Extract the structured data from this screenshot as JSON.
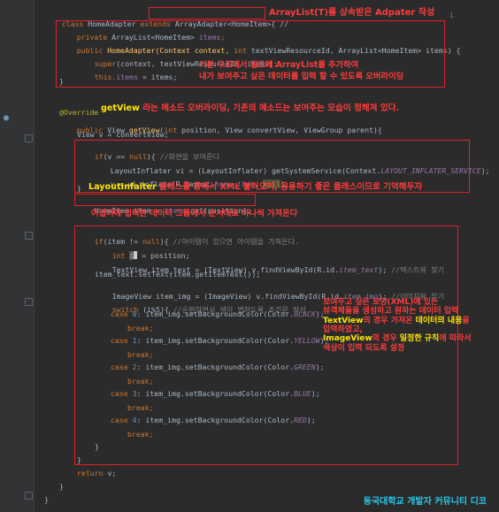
{
  "gutter": {
    "marker_glyph": "●"
  },
  "code": {
    "l01": {
      "a": "class ",
      "b": "HomeAdapter ",
      "c": "extends ",
      "d": "ArrayAdapter<HomeItem>{ //",
      "e": "i"
    },
    "l02": {
      "a": "private ",
      "b": "ArrayList<HomeItem> ",
      "c": "items",
      "d": ";"
    },
    "l03": {
      "a": "public ",
      "b": "HomeAdapter(Context context, ",
      "c": "int ",
      "d": "textViewResourceId, ArrayList<HomeItem> items) {"
    },
    "l04": {
      "a": "super",
      "b": "(context, textViewResourceId, items)",
      "c": ";"
    },
    "l05": {
      "a": "this.",
      "b": "items ",
      "c": "= items;"
    },
    "l06": {
      "a": "}"
    },
    "l07": {
      "a": "@Override"
    },
    "l08": {
      "a": "public ",
      "b": "View ",
      "c": "getView",
      "d": "(",
      "e": "int ",
      "f": "position, View convertView, ViewGroup parent){"
    },
    "l09": {
      "a": "View v = convertView;"
    },
    "l10": {
      "a": "if",
      "b": "(v == ",
      "c": "null",
      "d": "){ ",
      "e": "//화면을 보여준다"
    },
    "l11": {
      "a": "LayoutInflater vi = (LayoutInflater) getSystemService(Context.",
      "b": "LAYOUT_INFLATER_SERVICE",
      "c": ");"
    },
    "l12": {
      "a": "v = vi.inflate(R.layout.",
      "b": "home_item",
      "c": ", ",
      "d": "null",
      "e": ");"
    },
    "l13": {
      "a": "}"
    },
    "l14": {
      "a": "HomeItem item = ",
      "b": "items",
      "c": ".get(position);"
    },
    "l15": {
      "a": "if",
      "b": "(item != ",
      "c": "null",
      "d": "){ ",
      "e": "//아이템이 있으면 아이템을 가져온다."
    },
    "l16": {
      "a": "int ",
      "b": "i",
      "c": " = position;"
    },
    "l17": {
      "a": "TextView item_text = (TextView) v.findViewById(R.id.",
      "b": "item_text",
      "c": "); ",
      "d": "//텍스트뷰 찾기"
    },
    "l18": {
      "a": "item_text.setText(item.getItemText());"
    },
    "l19": {
      "a": "ImageView item_img = (ImageView) v.findViewById(R.id.",
      "b": "item_img",
      "c": "); ",
      "d": "//이미지뷰 찾기"
    },
    "l20": {
      "a": "switch ",
      "b": "(i%5){ ",
      "c": "//순환하면서 색이 변하도록 조건문 작성"
    },
    "c0": {
      "a": "case ",
      "b": "0",
      "c": ": item_img.setBackgroundColor(Color.",
      "d": "BLACK",
      "e": ");"
    },
    "c1": {
      "a": "case ",
      "b": "1",
      "c": ": item_img.setBackgroundColor(Color.",
      "d": "YELLOW",
      "e": ");"
    },
    "c2": {
      "a": "case ",
      "b": "2",
      "c": ": item_img.setBackgroundColor(Color.",
      "d": "GREEN",
      "e": ");"
    },
    "c3": {
      "a": "case ",
      "b": "3",
      "c": ": item_img.setBackgroundColor(Color.",
      "d": "BLUE",
      "e": ");"
    },
    "c4": {
      "a": "case ",
      "b": "4",
      "c": ": item_img.setBackgroundColor(Color.",
      "d": "RED",
      "e": ");"
    },
    "brk": "break;",
    "close": "}",
    "ret": {
      "a": "return ",
      "b": "v;"
    }
  },
  "annotations": {
    "a1": "ArrayList(T)를 상속받은 Adpater 작성",
    "a2_1": "기본 구조에서 필드에 ArrayList를 추가하여",
    "a2_2": "내가 보여주고 싶은 데이터를 입력 할 수 있도록 오버라이딩",
    "a3_y": "getView",
    "a3_r": " 라는 메소드 오버라이딩, 기존의 메소드는 보여주는 모습이 정해져 있다.",
    "a4_y": "LayoutInfalter",
    "a4_r": " 클래스를 통해서 XML 불러오기, 응용하기 좋은 클래스이므로 기억해두자",
    "a5": "어댑터에 입력한 데이터 그룹에서 순서대로 하나씩 가져온다",
    "a6_1": "보여주고 싶은 모양(XML)에 있는",
    "a6_2": "뷰객체들을 생성하고 원하는 데이터 입력",
    "a6_3y": "TextView",
    "a6_3r1": "의 경우 가져온 ",
    "a6_3y2": "데이터의 내용",
    "a6_3r2": "을",
    "a6_4": "입력하였고,",
    "a6_5y": "ImageView",
    "a6_5r1": "의 경우 ",
    "a6_5y2": "일정한 규칙",
    "a6_5r2": "에 따라서",
    "a6_6": "색상이 입력 되도록 설정"
  },
  "watermark": "동국대학교 개발자 커뮤니티 디코"
}
